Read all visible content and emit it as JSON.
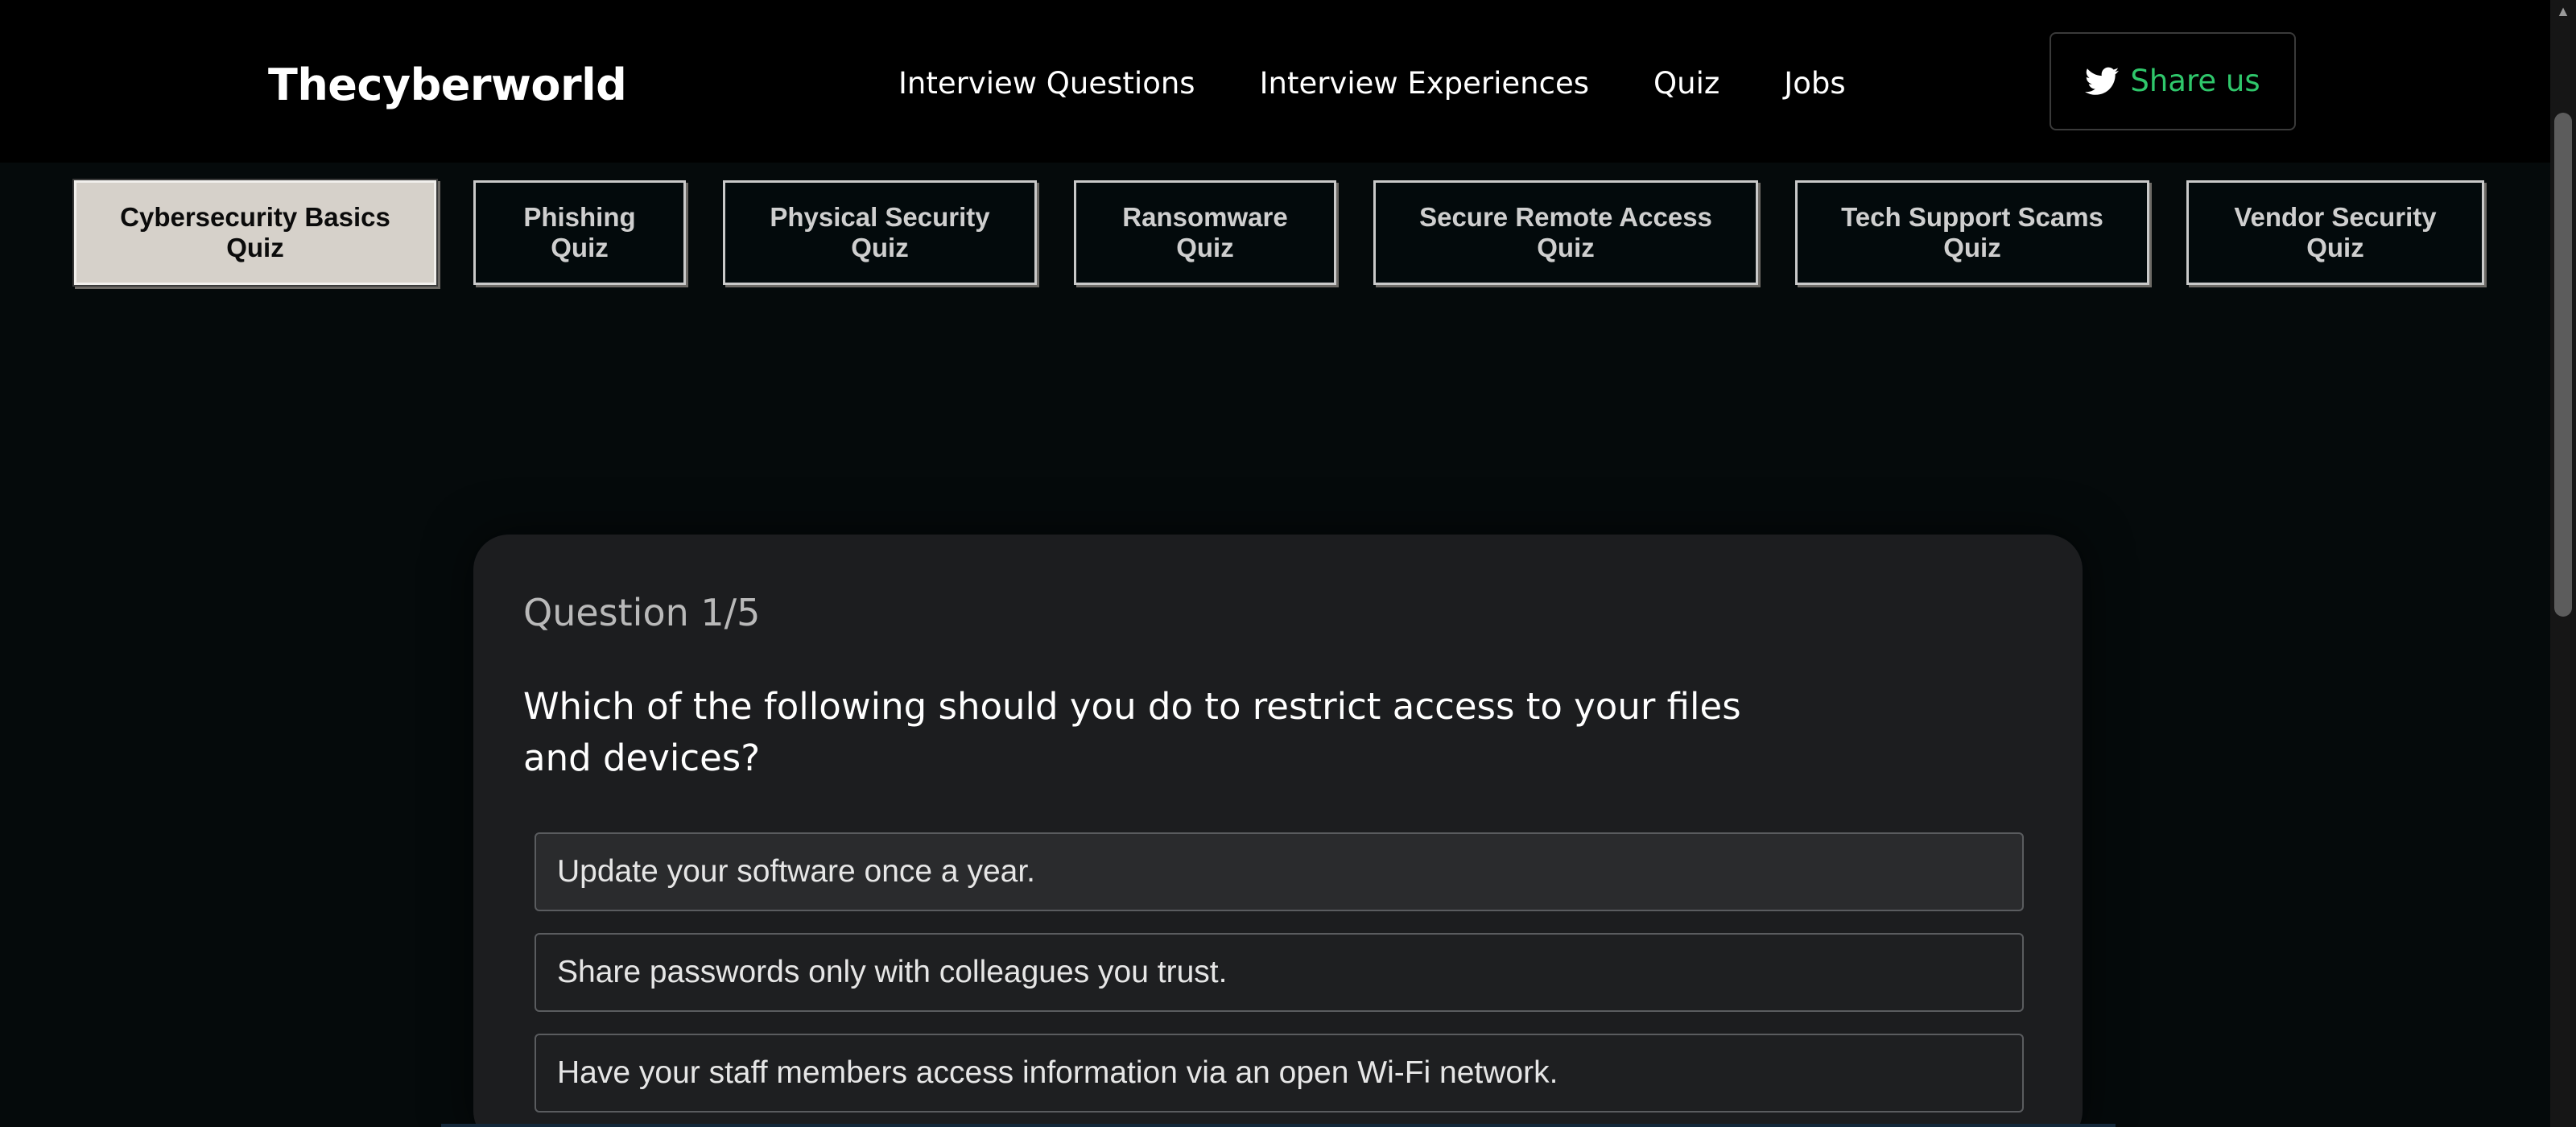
{
  "header": {
    "brand": "Thecyberworld",
    "nav": [
      {
        "label": "Interview Questions"
      },
      {
        "label": "Interview Experiences"
      },
      {
        "label": "Quiz"
      },
      {
        "label": "Jobs"
      }
    ],
    "share_label": "Share us",
    "share_icon": "twitter-icon",
    "accent_color": "#2fc76b"
  },
  "quiz_tabs": [
    {
      "line1": "Cybersecurity Basics",
      "line2": "Quiz",
      "active": true
    },
    {
      "line1": "Phishing",
      "line2": "Quiz",
      "active": false
    },
    {
      "line1": "Physical Security",
      "line2": "Quiz",
      "active": false
    },
    {
      "line1": "Ransomware",
      "line2": "Quiz",
      "active": false
    },
    {
      "line1": "Secure Remote Access",
      "line2": "Quiz",
      "active": false
    },
    {
      "line1": "Tech Support Scams",
      "line2": "Quiz",
      "active": false
    },
    {
      "line1": "Vendor Security",
      "line2": "Quiz",
      "active": false
    }
  ],
  "quiz": {
    "counter": "Question 1/5",
    "question": "Which of the following should you do to restrict access to your files and devices?",
    "answers": [
      "Update your software once a year.",
      "Share passwords only with colleagues you trust.",
      "Have your staff members access information via an open Wi-Fi network."
    ]
  }
}
